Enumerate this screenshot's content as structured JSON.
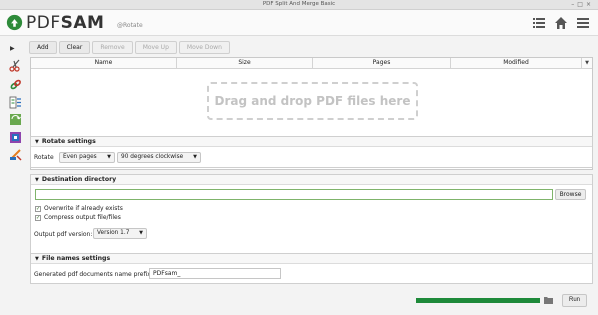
{
  "window": {
    "title": "PDF Split And Merge Basic"
  },
  "header": {
    "logo_prefix": "PDF",
    "logo_suffix": "SAM",
    "module_label": "@Rotate",
    "icons": [
      "list-icon",
      "home-icon",
      "menu-icon"
    ]
  },
  "left_toolbar": {
    "icons": [
      "expand-arrow-icon",
      "split-icon",
      "merge-icon",
      "extract-pages-icon",
      "rotate-icon",
      "alternate-mix-icon",
      "split-by-bookmarks-icon"
    ]
  },
  "selection_toolbar": {
    "add": "Add",
    "clear": "Clear",
    "remove": "Remove",
    "move_up": "Move Up",
    "move_down": "Move Down"
  },
  "table": {
    "columns": [
      "Name",
      "Size",
      "Pages",
      "Modified"
    ],
    "dropzone_text": "Drag and drop PDF files here"
  },
  "rotate_settings": {
    "title": "Rotate settings",
    "rotate_label": "Rotate",
    "pages_value": "Even pages",
    "degrees_value": "90 degrees clockwise"
  },
  "destination": {
    "title": "Destination directory",
    "directory_value": "",
    "browse_label": "Browse",
    "overwrite_label": "Overwrite if already exists",
    "overwrite_checked": true,
    "compress_label": "Compress output file/files",
    "compress_checked": true,
    "version_label": "Output pdf version:",
    "version_value": "Version 1.7"
  },
  "file_names": {
    "title": "File names settings",
    "prefix_label": "Generated pdf documents name prefix:",
    "prefix_value": "PDFsam_"
  },
  "footer": {
    "progress_fraction": 1.0,
    "run_label": "Run"
  },
  "colors": {
    "accent": "#1e8a3a",
    "logo_green": "#2e8b3a"
  }
}
